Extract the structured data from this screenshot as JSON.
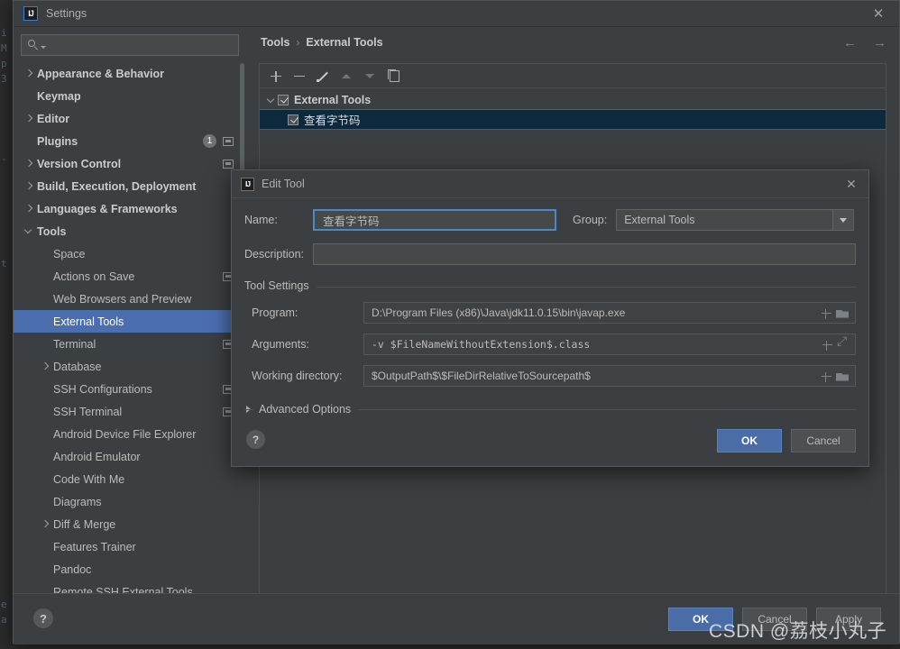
{
  "window": {
    "title": "Settings",
    "logo_text": "IJ",
    "close_icon": "✕"
  },
  "search": {
    "placeholder": "",
    "value": ""
  },
  "sidebar": {
    "items": [
      {
        "label": "Appearance & Behavior",
        "arrow": "right",
        "indent": 0,
        "bold": true,
        "badge": "",
        "proj_icon": false,
        "selected": false
      },
      {
        "label": "Keymap",
        "arrow": "none",
        "indent": 0,
        "bold": true,
        "badge": "",
        "proj_icon": false,
        "selected": false
      },
      {
        "label": "Editor",
        "arrow": "right",
        "indent": 0,
        "bold": true,
        "badge": "",
        "proj_icon": false,
        "selected": false
      },
      {
        "label": "Plugins",
        "arrow": "none",
        "indent": 0,
        "bold": true,
        "badge": "1",
        "proj_icon": true,
        "selected": false
      },
      {
        "label": "Version Control",
        "arrow": "right",
        "indent": 0,
        "bold": true,
        "badge": "",
        "proj_icon": true,
        "selected": false
      },
      {
        "label": "Build, Execution, Deployment",
        "arrow": "right",
        "indent": 0,
        "bold": true,
        "badge": "",
        "proj_icon": false,
        "selected": false
      },
      {
        "label": "Languages & Frameworks",
        "arrow": "right",
        "indent": 0,
        "bold": true,
        "badge": "",
        "proj_icon": false,
        "selected": false
      },
      {
        "label": "Tools",
        "arrow": "down",
        "indent": 0,
        "bold": true,
        "badge": "",
        "proj_icon": false,
        "selected": false
      },
      {
        "label": "Space",
        "arrow": "none",
        "indent": 1,
        "bold": false,
        "badge": "",
        "proj_icon": false,
        "selected": false
      },
      {
        "label": "Actions on Save",
        "arrow": "none",
        "indent": 1,
        "bold": false,
        "badge": "",
        "proj_icon": true,
        "selected": false
      },
      {
        "label": "Web Browsers and Preview",
        "arrow": "none",
        "indent": 1,
        "bold": false,
        "badge": "",
        "proj_icon": false,
        "selected": false
      },
      {
        "label": "External Tools",
        "arrow": "none",
        "indent": 1,
        "bold": false,
        "badge": "",
        "proj_icon": false,
        "selected": true
      },
      {
        "label": "Terminal",
        "arrow": "none",
        "indent": 1,
        "bold": false,
        "badge": "",
        "proj_icon": true,
        "selected": false
      },
      {
        "label": "Database",
        "arrow": "right",
        "indent": 1,
        "bold": false,
        "badge": "",
        "proj_icon": false,
        "selected": false
      },
      {
        "label": "SSH Configurations",
        "arrow": "none",
        "indent": 1,
        "bold": false,
        "badge": "",
        "proj_icon": true,
        "selected": false
      },
      {
        "label": "SSH Terminal",
        "arrow": "none",
        "indent": 1,
        "bold": false,
        "badge": "",
        "proj_icon": true,
        "selected": false
      },
      {
        "label": "Android Device File Explorer",
        "arrow": "none",
        "indent": 1,
        "bold": false,
        "badge": "",
        "proj_icon": false,
        "selected": false
      },
      {
        "label": "Android Emulator",
        "arrow": "none",
        "indent": 1,
        "bold": false,
        "badge": "",
        "proj_icon": false,
        "selected": false
      },
      {
        "label": "Code With Me",
        "arrow": "none",
        "indent": 1,
        "bold": false,
        "badge": "",
        "proj_icon": false,
        "selected": false
      },
      {
        "label": "Diagrams",
        "arrow": "none",
        "indent": 1,
        "bold": false,
        "badge": "",
        "proj_icon": false,
        "selected": false
      },
      {
        "label": "Diff & Merge",
        "arrow": "right",
        "indent": 1,
        "bold": false,
        "badge": "",
        "proj_icon": false,
        "selected": false
      },
      {
        "label": "Features Trainer",
        "arrow": "none",
        "indent": 1,
        "bold": false,
        "badge": "",
        "proj_icon": false,
        "selected": false
      },
      {
        "label": "Pandoc",
        "arrow": "none",
        "indent": 1,
        "bold": false,
        "badge": "",
        "proj_icon": false,
        "selected": false
      },
      {
        "label": "Remote SSH External Tools",
        "arrow": "none",
        "indent": 1,
        "bold": false,
        "badge": "",
        "proj_icon": false,
        "selected": false
      }
    ]
  },
  "content": {
    "breadcrumb": {
      "parent": "Tools",
      "separator": "›",
      "current": "External Tools"
    },
    "nav": {
      "back": "←",
      "forward": "→"
    },
    "toolbar": [
      {
        "name": "add",
        "glyph": "+",
        "enabled": true
      },
      {
        "name": "remove",
        "glyph": "−",
        "enabled": true
      },
      {
        "name": "edit",
        "glyph": "✎",
        "enabled": true
      },
      {
        "name": "move-up",
        "glyph": "▲",
        "enabled": false
      },
      {
        "name": "move-down",
        "glyph": "▼",
        "enabled": false
      },
      {
        "name": "copy",
        "glyph": "⧉",
        "enabled": true
      }
    ],
    "tree": [
      {
        "label": "External Tools",
        "checked": true,
        "expanded": true,
        "level": 0,
        "selected": false
      },
      {
        "label": "查看字节码",
        "checked": true,
        "expanded": false,
        "level": 1,
        "selected": true
      }
    ]
  },
  "bottom_bar": {
    "help_label": "?",
    "ok_label": "OK",
    "cancel_label": "Cancel",
    "apply_label": "Apply"
  },
  "modal": {
    "title": "Edit Tool",
    "logo_text": "IJ",
    "close_icon": "✕",
    "name_label": "Name:",
    "name_value": "查看字节码",
    "group_label": "Group:",
    "group_value": "External Tools",
    "description_label": "Description:",
    "description_value": "",
    "tool_settings_title": "Tool Settings",
    "program_label": "Program:",
    "program_value": "D:\\Program Files (x86)\\Java\\jdk11.0.15\\bin\\javap.exe",
    "arguments_label": "Arguments:",
    "arguments_value": "-v $FileNameWithoutExtension$.class",
    "working_dir_label": "Working directory:",
    "working_dir_value": "$OutputPath$\\$FileDirRelativeToSourcepath$",
    "advanced_options_label": "Advanced Options",
    "help_label": "?",
    "ok_label": "OK",
    "cancel_label": "Cancel"
  },
  "watermark": {
    "text": "CSDN @荔枝小丸子"
  },
  "ide_background": {
    "gutter_lines": [
      "i",
      "M",
      "p",
      "3",
      "",
      "",
      "",
      "t",
      "",
      "",
      "",
      "",
      "",
      "",
      "",
      "e",
      "a"
    ]
  },
  "colors": {
    "accent_blue": "#4b6eaf",
    "selection_tree": "#0d293e",
    "panel_bg": "#3c3f41",
    "field_bg": "#45494a",
    "focus_border": "#4a88c7"
  }
}
